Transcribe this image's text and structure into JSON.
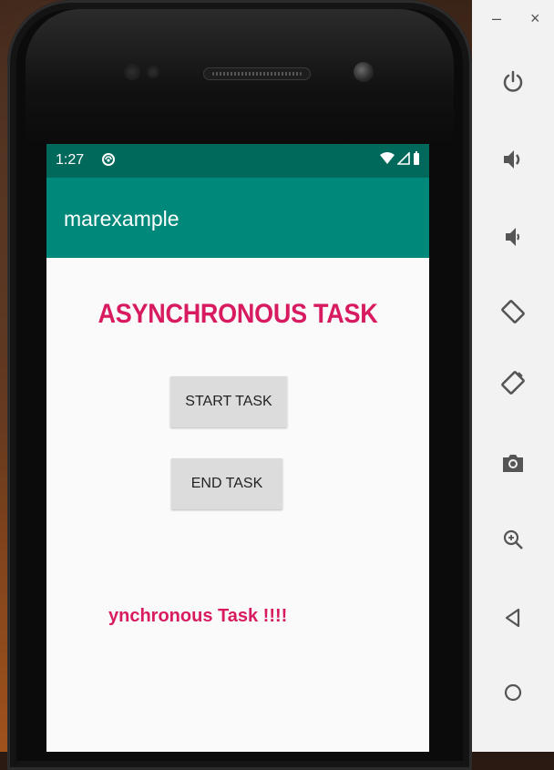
{
  "status_bar": {
    "time": "1:27",
    "app_icon": "sync-icon",
    "icons": [
      "wifi-icon",
      "signal-icon",
      "battery-icon"
    ]
  },
  "app_bar": {
    "title": "marexample"
  },
  "main": {
    "heading": "ASYNCHRONOUS TASK",
    "start_button": "START TASK",
    "end_button": "END TASK",
    "result_text": "ynchronous Task !!!!"
  },
  "emulator_toolbar": {
    "minimize": "–",
    "close": "×",
    "buttons": [
      "power-icon",
      "volume-up-icon",
      "volume-down-icon",
      "rotate-left-icon",
      "rotate-right-icon",
      "screenshot-icon",
      "zoom-icon",
      "back-icon",
      "home-icon"
    ]
  },
  "colors": {
    "status_bar": "#00695c",
    "app_bar": "#00897b",
    "accent_text": "#d81b60",
    "button_bg": "#dcdcdc",
    "toolbar_bg": "#f2f2f2"
  }
}
